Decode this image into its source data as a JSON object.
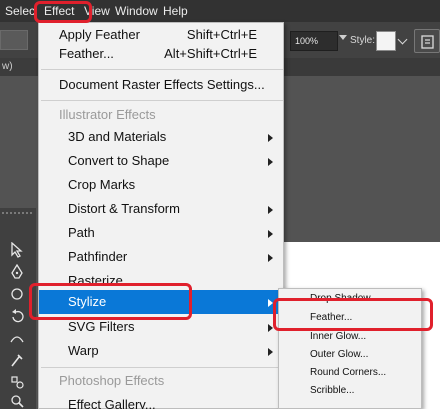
{
  "menubar": {
    "items": [
      {
        "label": "Selec"
      },
      {
        "label": "Effect"
      },
      {
        "label": "View"
      },
      {
        "label": "Window"
      },
      {
        "label": "Help"
      }
    ]
  },
  "controlbar": {
    "opacity": "100%",
    "style_label": "Style:",
    "swatch_color": "#f4f4f4"
  },
  "document": {
    "tab_label": "w)"
  },
  "effect_menu": {
    "apply_feather": {
      "label": "Apply Feather",
      "shortcut": "Shift+Ctrl+E"
    },
    "feather": {
      "label": "Feather...",
      "shortcut": "Alt+Shift+Ctrl+E"
    },
    "raster_settings": {
      "label": "Document Raster Effects Settings..."
    },
    "illustrator_section": "Illustrator Effects",
    "illustrator_items": [
      {
        "label": "3D and Materials",
        "submenu": true
      },
      {
        "label": "Convert to Shape",
        "submenu": true
      },
      {
        "label": "Crop Marks",
        "submenu": false
      },
      {
        "label": "Distort & Transform",
        "submenu": true
      },
      {
        "label": "Path",
        "submenu": true
      },
      {
        "label": "Pathfinder",
        "submenu": true
      },
      {
        "label": "Rasterize...",
        "submenu": false
      },
      {
        "label": "Stylize",
        "submenu": true,
        "selected": true
      },
      {
        "label": "SVG Filters",
        "submenu": true
      },
      {
        "label": "Warp",
        "submenu": true
      }
    ],
    "photoshop_section": "Photoshop Effects",
    "photoshop_items": [
      {
        "label": "Effect Gallery..."
      }
    ]
  },
  "stylize_submenu": {
    "items": [
      {
        "label": "Drop Shadow..."
      },
      {
        "label": "Feather..."
      },
      {
        "label": "Inner Glow..."
      },
      {
        "label": "Outer Glow..."
      },
      {
        "label": "Round Corners..."
      },
      {
        "label": "Scribble..."
      }
    ]
  },
  "colors": {
    "menu_highlight": "#0a78d7",
    "annotation_red": "#e0202c",
    "menu_bg": "#f2f2f2",
    "app_bg": "#535353"
  }
}
